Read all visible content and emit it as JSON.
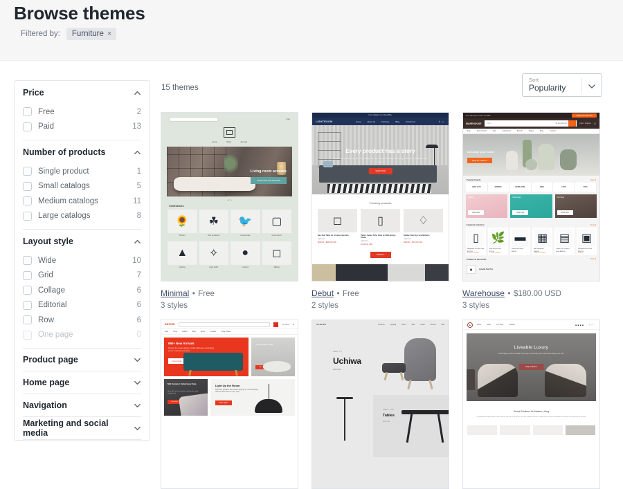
{
  "header": {
    "title": "Browse themes",
    "filtered_by_label": "Filtered by:",
    "filter_tag": "Furniture",
    "filter_tag_remove": "×"
  },
  "sidebar": {
    "groups": [
      {
        "title": "Price",
        "expanded": true,
        "chevron": "chevron-up-icon",
        "items": [
          {
            "label": "Free",
            "count": "2",
            "disabled": false
          },
          {
            "label": "Paid",
            "count": "13",
            "disabled": false
          }
        ]
      },
      {
        "title": "Number of products",
        "expanded": true,
        "chevron": "chevron-up-icon",
        "items": [
          {
            "label": "Single product",
            "count": "1",
            "disabled": false
          },
          {
            "label": "Small catalogs",
            "count": "5",
            "disabled": false
          },
          {
            "label": "Medium catalogs",
            "count": "11",
            "disabled": false
          },
          {
            "label": "Large catalogs",
            "count": "8",
            "disabled": false
          }
        ]
      },
      {
        "title": "Layout style",
        "expanded": true,
        "chevron": "chevron-up-icon",
        "items": [
          {
            "label": "Wide",
            "count": "10",
            "disabled": false
          },
          {
            "label": "Grid",
            "count": "7",
            "disabled": false
          },
          {
            "label": "Collage",
            "count": "6",
            "disabled": false
          },
          {
            "label": "Editorial",
            "count": "6",
            "disabled": false
          },
          {
            "label": "Row",
            "count": "6",
            "disabled": false
          },
          {
            "label": "One page",
            "count": "0",
            "disabled": true
          }
        ]
      }
    ],
    "collapsed_groups": [
      {
        "title": "Product page",
        "chevron": "chevron-down-icon"
      },
      {
        "title": "Home page",
        "chevron": "chevron-down-icon"
      },
      {
        "title": "Navigation",
        "chevron": "chevron-down-icon"
      },
      {
        "title": "Marketing and social media",
        "chevron": "chevron-down-icon"
      }
    ]
  },
  "toolbar": {
    "theme_count": "15 themes",
    "sort": {
      "caption": "Sort",
      "value": "Popularity",
      "chevron": "chevron-down-icon"
    }
  },
  "themes": [
    {
      "name": "Minimal",
      "separator": "•",
      "price": "Free",
      "styles": "3 styles"
    },
    {
      "name": "Debut",
      "separator": "•",
      "price": "Free",
      "styles": "2 styles"
    },
    {
      "name": "Warehouse",
      "separator": "•",
      "price": "$180.00 USD",
      "styles": "3 styles"
    },
    {
      "name": "",
      "separator": "",
      "price": "",
      "styles": ""
    },
    {
      "name": "",
      "separator": "",
      "price": "",
      "styles": ""
    },
    {
      "name": "",
      "separator": "",
      "price": "",
      "styles": ""
    }
  ],
  "thumbnails": {
    "minimal": {
      "search_placeholder": "Search",
      "cart": "Cart",
      "nav": [
        "Home",
        "Shop",
        "Journal"
      ],
      "hero_title": "Living room accents",
      "hero_button": "SHOP OUR COLLECTION",
      "section": "Collections",
      "captions": [
        "Kitchen",
        "Pots & planters",
        "Accessories",
        "Home decor",
        "Lighting",
        "Light bulbs",
        "Candles",
        "Pillows"
      ]
    },
    "debut": {
      "announcement": "Free shipping on orders $50+",
      "logo": "LIGHTROOM",
      "nav": [
        "Home",
        "About Us",
        "Furniture",
        "Blog",
        "Contact Us"
      ],
      "hero_title": "Every product has a story",
      "hero_sub": "Superior craftsmanship, enduring designs and timeless silhouettes. Bringing products of quality to your home.",
      "hero_button": "SHOP NOW",
      "section": "Trending products",
      "products": [
        {
          "name": "Bay Side Table by Cristina Celestino",
          "meta": "Lightroom",
          "price": "$240.00 – $380.00 USD"
        },
        {
          "name": "Palm 4 Seater Sofa, Slate by Wild Design Studio",
          "meta": "Lightroom",
          "price": "$1,200.00 USD"
        },
        {
          "name": "Halifax Chair by Luca Nichetto",
          "meta": "Lightroom",
          "price": "$390.00 – $470.00 USD"
        }
      ],
      "button2": "VIEW ALL"
    },
    "warehouse": {
      "topbar": "Free shipping on orders over $99",
      "top_button": "Create your own store",
      "logo": "WAREHOUSE",
      "search_placeholder": "Store",
      "search_category": "All departments",
      "account": "Login / Register",
      "cart_label": "Cart",
      "nav": [
        "Shop",
        "New Arrivals",
        "Sale",
        "Collections",
        "Brands",
        "Pages",
        "Blog",
        "Contact"
      ],
      "hero_title": "Decorate your home",
      "hero_button": "Shop the collection",
      "section1": "Popular brands",
      "section1_link": "View all",
      "brands": [
        "ARIA LIVE",
        "NORDIC",
        "HEIRLOOM",
        "ORB",
        "LUMI",
        "KIVA"
      ],
      "collections": [
        {
          "title": "Lighting",
          "button": "Shop Now"
        },
        {
          "title": "Homeware",
          "button": "Shop Now"
        },
        {
          "title": "Furniture",
          "button": "Shop Now"
        }
      ],
      "section2": "Featured collection",
      "section2_link": "View all",
      "products": [
        {
          "name": "Bridgeport 3 Drawer Unit",
          "price": "$179.00",
          "label": "4 colors available"
        },
        {
          "name": "Mercer Bud Vase",
          "price": "$27.00",
          "label": "2 sizes available"
        },
        {
          "name": "Linden Wall Shelf",
          "price": "$89.00",
          "label": ""
        },
        {
          "name": "Ash Sideboard",
          "price": "$580.00",
          "label": "3 colors available"
        },
        {
          "name": "Timber Oak Cabinet",
          "price": "From $890.00",
          "label": ""
        },
        {
          "name": "Nest Armchair Fabric",
          "price": "$410.00",
          "label": "2 colors"
        }
      ],
      "section3": "Product of the month",
      "product_of_month": "Amelia Tea Pot"
    },
    "empire": {
      "logo": "EMPIRE",
      "account": "Your Name",
      "nav": [
        "Sale",
        "Shop",
        "Search",
        "Blog",
        "About",
        "Contact",
        "Track Orders"
      ],
      "banner_title": "690+ New Arrivals",
      "banner_sub": "Discover the newest designs, modern silhouettes and timeless pieces curated for your space.",
      "banner_button": "New Arrivals",
      "side_title": "Shop Furniture Sale",
      "side_button": "Shop Now",
      "left2_title": "Mid Summer Upholstery Sale",
      "left2_sub": "Up to 40% off select fabrics and finishes while supplies last.",
      "left2_button": "View Sale",
      "right2_title": "Light Up the Room",
      "right2_sub": "Statement pendants and modern lighting, our curated lighting collection that works in every room.",
      "right2_button": "Shop Lights"
    },
    "uchiwa": {
      "logo": "UCHIWA",
      "nav": [
        "Furniture",
        "Lighting",
        "Decor",
        "Sale",
        "About",
        "Journal",
        "Cart"
      ],
      "kicker": "NEW IN",
      "title": "Uchiwa",
      "more": "EXPLORE",
      "kicker2": "SHOP THE",
      "title2": "Tables",
      "more2": "EXPLORE"
    },
    "liveable": {
      "nav": [
        "Home",
        "Shop",
        "Our Story",
        "Contact"
      ],
      "hero_title": "Liveable Luxury",
      "hero_sub": "Contemporary furniture crafted for the way you live today, with comfort and quality at the core.",
      "hero_button": "Shop Collection",
      "section": "Smart Solutions for Modern Living",
      "section_sub": "Thoughtfully designed pieces that make the most of every space. Discover modular storage, multipurpose seating and flexible furnishings that grow with your home."
    }
  }
}
